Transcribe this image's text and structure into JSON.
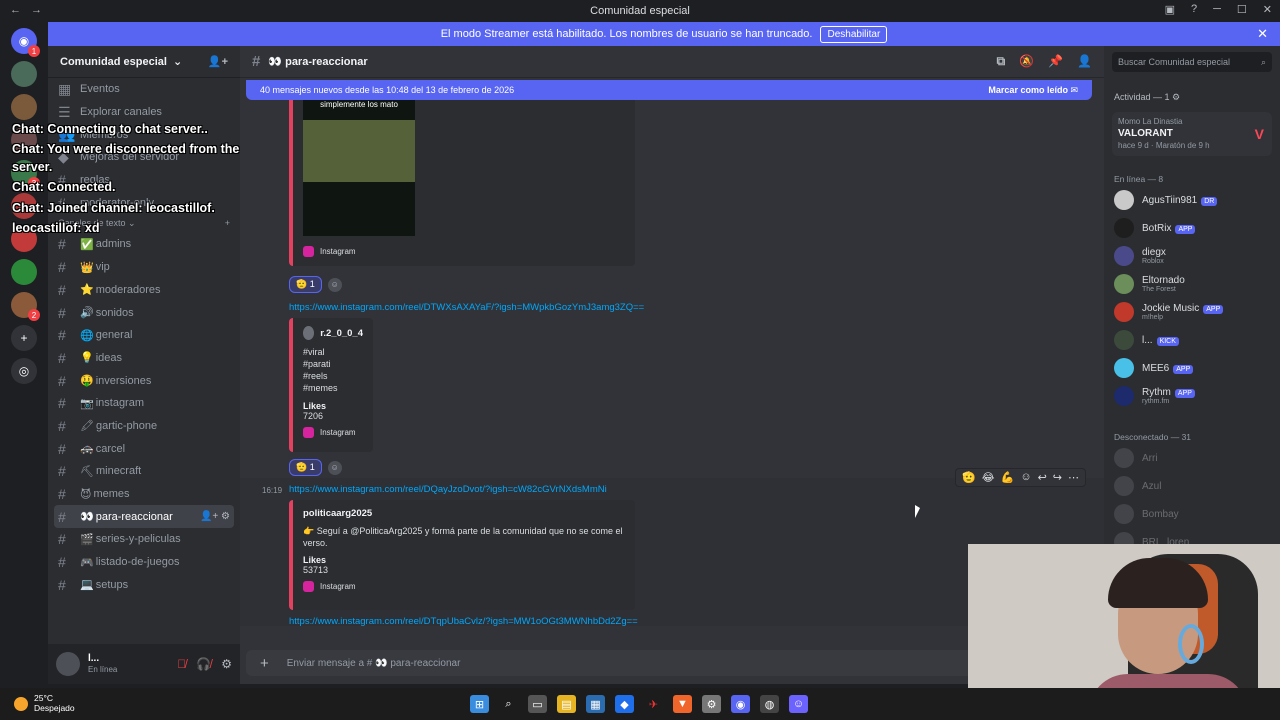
{
  "window": {
    "title": "Comunidad especial"
  },
  "streamer_bar": {
    "message": "El modo Streamer está habilitado. Los nombres de usuario se han truncado.",
    "button": "Deshabilitar"
  },
  "guilds": {
    "badges": [
      "1",
      "3",
      "2"
    ]
  },
  "server": {
    "name": "Comunidad especial",
    "top_items": [
      "Eventos",
      "Explorar canales",
      "Miembros",
      "Mejoras del servidor"
    ],
    "partial_channels": [
      "reglas",
      "moderator-only"
    ],
    "category": "Canales de texto",
    "channels": [
      {
        "emoji": "✅",
        "name": "admins"
      },
      {
        "emoji": "👑",
        "name": "vip"
      },
      {
        "emoji": "⭐",
        "name": "moderadores"
      },
      {
        "emoji": "🔊",
        "name": "sonidos"
      },
      {
        "emoji": "🌐",
        "name": "general"
      },
      {
        "emoji": "💡",
        "name": "ideas"
      },
      {
        "emoji": "🤑",
        "name": "inversiones"
      },
      {
        "emoji": "📷",
        "name": "instagram"
      },
      {
        "emoji": "🖍",
        "name": "gartic-phone"
      },
      {
        "emoji": "🚓",
        "name": "carcel"
      },
      {
        "emoji": "⛏",
        "name": "minecraft"
      },
      {
        "emoji": "😈",
        "name": "memes"
      },
      {
        "emoji": "👀",
        "name": "para-reaccionar"
      },
      {
        "emoji": "🎬",
        "name": "series-y-peliculas"
      },
      {
        "emoji": "🎮",
        "name": "listado-de-juegos"
      },
      {
        "emoji": "💻",
        "name": "setups"
      }
    ],
    "active_channel": "para-reaccionar"
  },
  "user_panel": {
    "name": "l...",
    "status": "En línea"
  },
  "stream_overlay": [
    "Chat: Connecting to chat server..",
    "Chat: You were disconnected from the server.",
    "Chat: Connected.",
    "Chat: Joined channel: leocastillof.",
    "leocastillof: xd"
  ],
  "channel_header": {
    "name": "👀 para-reaccionar"
  },
  "new_messages_bar": {
    "text": "40 mensajes nuevos desde las 10:48 del 13 de febrero de 2026",
    "action": "Marcar como leído"
  },
  "messages": {
    "embed1": {
      "caption": "simplemente los mato",
      "footer": "Instagram"
    },
    "reaction1": {
      "emoji": "🫡",
      "count": "1"
    },
    "link2": "https://www.instagram.com/reel/DTWXsAXAYaF/?igsh=MWpkbGozYmJ3amg3ZQ==",
    "embed2": {
      "author": "r.2_0_0_4",
      "lines": [
        "#viral",
        "#parati",
        "#reels",
        "#memes"
      ],
      "field_name": "Likes",
      "field_value": "7206",
      "footer": "Instagram"
    },
    "reaction2": {
      "emoji": "🫡",
      "count": "1"
    },
    "time3": "16:19",
    "link3": "https://www.instagram.com/reel/DQayJzoDvot/?igsh=cW82cGVrNXdsMmNi",
    "embed3": {
      "author": "politicaarg2025",
      "body": "👉 Seguí a @PoliticaArg2025 y formá parte de la comunidad que no se come el verso.",
      "field_name": "Likes",
      "field_value": "53713",
      "footer": "Instagram"
    },
    "link4": "https://www.instagram.com/reel/DTqpUbaCvlz/?igsh=MW1oOGt3MWNhbDd2Zg=="
  },
  "hover_tools": [
    "🫡",
    "😂",
    "💪"
  ],
  "composer": {
    "placeholder": "Enviar mensaje a # 👀 para-reaccionar"
  },
  "members": {
    "search_placeholder": "Buscar Comunidad especial",
    "activity_title": "Actividad — 1",
    "activity": {
      "user": "Momo La Dinastia",
      "game": "VALORANT",
      "time": "hace 9 d",
      "detail": "Maratón de 9 h"
    },
    "online_title": "En línea — 8",
    "online": [
      {
        "name": "AgusTiin981",
        "tag": "DR",
        "sub": "",
        "color": "#c9c9c9"
      },
      {
        "name": "BotRix",
        "tag": "APP",
        "sub": "",
        "color": "#1e1e1e"
      },
      {
        "name": "diegx",
        "tag": "",
        "sub": "Roblox",
        "color": "#4a4a8a"
      },
      {
        "name": "Eltornado",
        "tag": "",
        "sub": "The Forest",
        "color": "#6b8e5a"
      },
      {
        "name": "Jockie Music",
        "tag": "APP",
        "sub": "m!help",
        "color": "#c0392b"
      },
      {
        "name": "l...",
        "tag": "KICK",
        "sub": "",
        "color": "#3c4a3c"
      },
      {
        "name": "MEE6",
        "tag": "APP",
        "sub": "",
        "color": "#49c0e8"
      },
      {
        "name": "Rythm",
        "tag": "APP",
        "sub": "rythm.fm",
        "color": "#1d2a6b"
      }
    ],
    "offline_title": "Desconectado — 31",
    "offline": [
      "Arri",
      "Azul",
      "Bombay",
      "BRL_loren"
    ]
  },
  "taskbar": {
    "temp": "25°C",
    "weather": "Despejado"
  }
}
